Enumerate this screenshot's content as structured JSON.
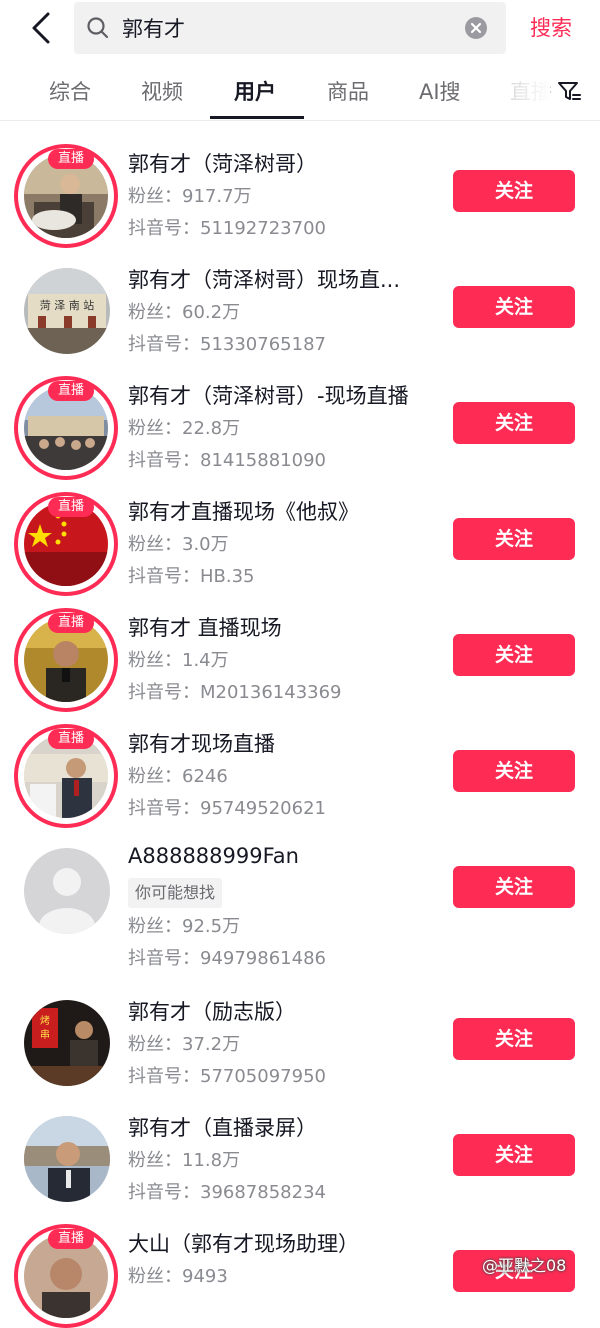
{
  "search": {
    "query": "郭有才",
    "submit_label": "搜索"
  },
  "tabs": [
    {
      "label": "综合"
    },
    {
      "label": "视频"
    },
    {
      "label": "用户"
    },
    {
      "label": "商品"
    },
    {
      "label": "AI搜"
    },
    {
      "label": "直播"
    }
  ],
  "active_tab": "用户",
  "follow_label": "关注",
  "live_label": "直播",
  "fans_prefix": "粉丝：",
  "douyin_prefix": "抖音号：",
  "users": [
    {
      "name": "郭有才（菏泽树哥）",
      "fans": "917.7万",
      "douyin_id": "51192723700",
      "live": true
    },
    {
      "name": "郭有才（菏泽树哥）现场直...",
      "fans": "60.2万",
      "douyin_id": "51330765187",
      "live": false
    },
    {
      "name": "郭有才（菏泽树哥）-现场直播",
      "fans": "22.8万",
      "douyin_id": "81415881090",
      "live": true
    },
    {
      "name": "郭有才直播现场《他叔》",
      "fans": "3.0万",
      "douyin_id": "HB.35",
      "live": true
    },
    {
      "name": "郭有才  直播现场",
      "fans": "1.4万",
      "douyin_id": "M20136143369",
      "live": true
    },
    {
      "name": "郭有才现场直播",
      "fans": "6246",
      "douyin_id": "95749520621",
      "live": true
    },
    {
      "name": "A888888999Fan",
      "hint": "你可能想找",
      "fans": "92.5万",
      "douyin_id": "94979861486",
      "live": false
    },
    {
      "name": "郭有才（励志版）",
      "fans": "37.2万",
      "douyin_id": "57705097950",
      "live": false
    },
    {
      "name": "郭有才（直播录屏）",
      "fans": "11.8万",
      "douyin_id": "39687858234",
      "live": false
    },
    {
      "name": "大山（郭有才现场助理）",
      "fans": "9493",
      "live": true
    }
  ],
  "watermark": "@亚默之08",
  "colors": {
    "accent": "#fe2c55",
    "text": "#161823",
    "secondary": "#8a8b91"
  }
}
